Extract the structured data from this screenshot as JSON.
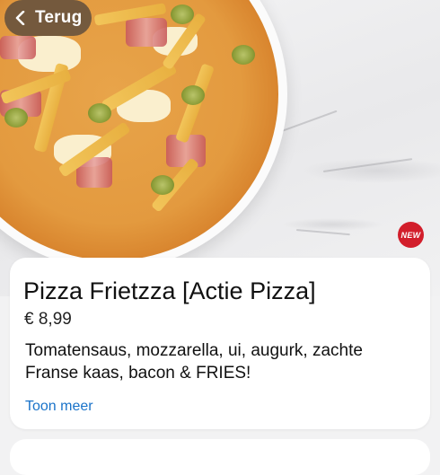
{
  "nav": {
    "back_label": "Terug"
  },
  "hero": {
    "badge": "NEW"
  },
  "product": {
    "name": "Pizza Frietzza [Actie Pizza]",
    "price": "€ 8,99",
    "description": "Tomatensaus, mozzarella, ui, augurk, zachte Franse kaas, bacon & FRIES!",
    "more_label": "Toon meer"
  },
  "colors": {
    "accent_link": "#1a73c9",
    "badge_red": "#d21e2b"
  }
}
